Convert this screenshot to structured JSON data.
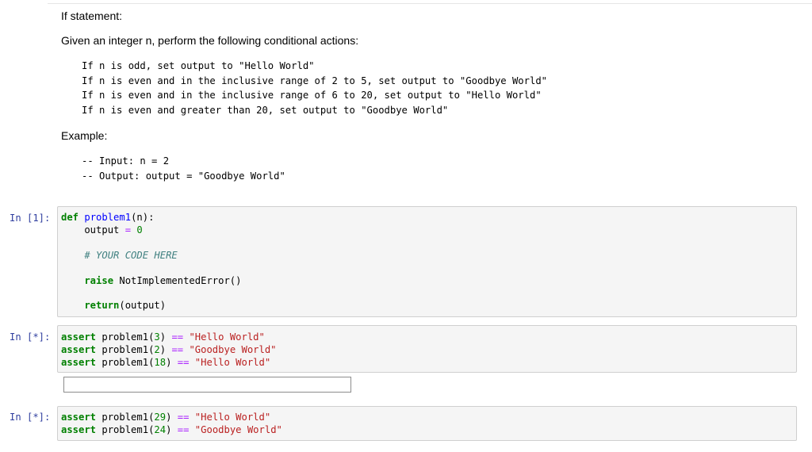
{
  "markdown": {
    "title": "If statement:",
    "intro": "Given an integer n, perform the following conditional actions:",
    "rules": [
      "If n is odd, set output to \"Hello World\"",
      "If n is even and in the inclusive range of 2 to 5, set output to \"Goodbye World\"",
      "If n is even and in the inclusive range of 6 to 20, set output to \"Hello World\"",
      "If n is even and greater than 20, set output to \"Goodbye World\""
    ],
    "example_label": "Example:",
    "example_lines": [
      "-- Input: n = 2",
      "-- Output: output = \"Goodbye World\""
    ]
  },
  "cells": [
    {
      "prompt": "In [1]:",
      "lines": {
        "l1": {
          "kw": "def",
          "fn": "problem1",
          "rest": "(n):"
        },
        "l2": {
          "lhs": "    output ",
          "op": "=",
          "num": "0"
        },
        "l3": {
          "comment": "    # YOUR CODE HERE"
        },
        "l4": {
          "kw": "    raise",
          "rest": " NotImplementedError()"
        },
        "l5": {
          "kw": "    return",
          "rest": "(output)"
        }
      }
    },
    {
      "prompt": "In [*]:",
      "asserts": [
        {
          "kw": "assert",
          "call": " problem1(",
          "num": "3",
          "close": ") ",
          "op": "==",
          "str": " \"Hello World\""
        },
        {
          "kw": "assert",
          "call": " problem1(",
          "num": "2",
          "close": ") ",
          "op": "==",
          "str": " \"Goodbye World\""
        },
        {
          "kw": "assert",
          "call": " problem1(",
          "num": "18",
          "close": ") ",
          "op": "==",
          "str": " \"Hello World\""
        }
      ]
    },
    {
      "prompt": "In [*]:",
      "asserts": [
        {
          "kw": "assert",
          "call": " problem1(",
          "num": "29",
          "close": ") ",
          "op": "==",
          "str": " \"Hello World\""
        },
        {
          "kw": "assert",
          "call": " problem1(",
          "num": "24",
          "close": ") ",
          "op": "==",
          "str": " \"Goodbye World\""
        }
      ]
    }
  ],
  "stdin_input": {
    "value": ""
  },
  "colors": {
    "prompt": "#303f9f",
    "keyword": "#008000",
    "function": "#0000ff",
    "string": "#ba2121",
    "operator": "#aa22ff",
    "comment": "#408080",
    "cell_bg": "#f5f5f5"
  }
}
